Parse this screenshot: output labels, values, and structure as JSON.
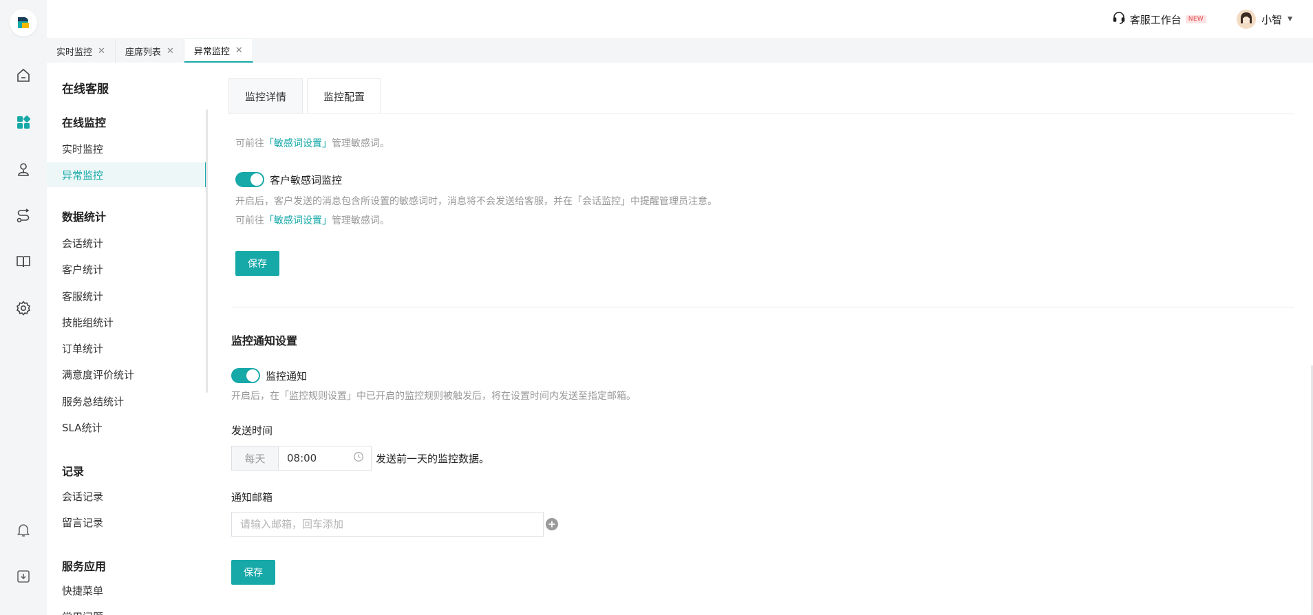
{
  "topbar": {
    "workbench_label": "客服工作台",
    "new_badge": "NEW",
    "user_name": "小智"
  },
  "page_tabs": [
    {
      "label": "实时监控",
      "active": false
    },
    {
      "label": "座席列表",
      "active": false
    },
    {
      "label": "异常监控",
      "active": true
    }
  ],
  "sidebar": {
    "title": "在线客服",
    "groups": [
      {
        "title": "在线监控",
        "items": [
          "实时监控",
          "异常监控"
        ]
      },
      {
        "title": "数据统计",
        "items": [
          "会话统计",
          "客户统计",
          "客服统计",
          "技能组统计",
          "订单统计",
          "满意度评价统计",
          "服务总结统计",
          "SLA统计"
        ]
      },
      {
        "title": "记录",
        "items": [
          "会话记录",
          "留言记录"
        ]
      },
      {
        "title": "服务应用",
        "items": [
          "快捷菜单",
          "常用问题"
        ]
      }
    ],
    "active_item": "异常监控"
  },
  "content_tabs": {
    "detail": "监控详情",
    "config": "监控配置"
  },
  "sensitive": {
    "hint_prefix": "可前往",
    "hint_link": "「敏感词设置」",
    "hint_suffix": "管理敏感词。",
    "customer_toggle_label": "客户敏感词监控",
    "customer_desc": "开启后，客户发送的消息包含所设置的敏感词时，消息将不会发送给客服，并在「会话监控」中提醒管理员注意。",
    "save_label": "保存"
  },
  "notify": {
    "section_title": "监控通知设置",
    "toggle_label": "监控通知",
    "desc": "开启后，在「监控规则设置」中已开启的监控规则被触发后，将在设置时间内发送至指定邮箱。",
    "send_time_label": "发送时间",
    "time_prefix": "每天",
    "time_value": "08:00",
    "time_suffix": "发送前一天的监控数据。",
    "email_label": "通知邮箱",
    "email_placeholder": "请输入邮箱，回车添加",
    "save_label": "保存"
  },
  "colors": {
    "accent": "#17a8a8",
    "new_badge": "#e0484a"
  },
  "icons": {
    "rail": [
      "home-icon",
      "dashboard-icon",
      "agent-icon",
      "route-icon",
      "book-icon",
      "settings-icon",
      "bell-icon",
      "download-icon"
    ]
  }
}
